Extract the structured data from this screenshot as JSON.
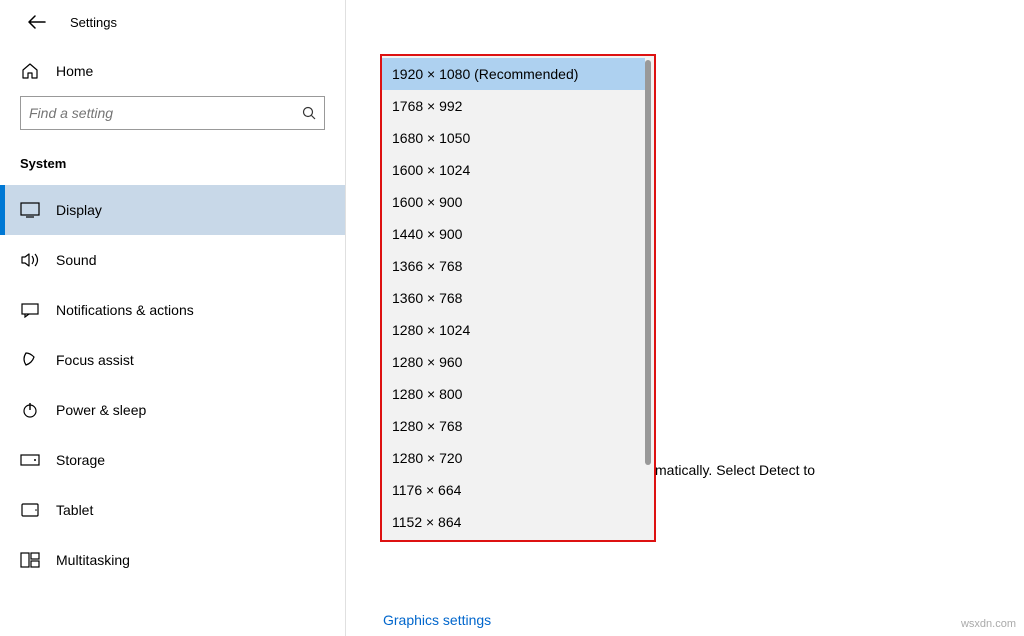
{
  "header": {
    "title": "Settings"
  },
  "sidebar": {
    "home": "Home",
    "searchPlaceholder": "Find a setting",
    "category": "System",
    "items": [
      {
        "label": "Display"
      },
      {
        "label": "Sound"
      },
      {
        "label": "Notifications & actions"
      },
      {
        "label": "Focus assist"
      },
      {
        "label": "Power & sleep"
      },
      {
        "label": "Storage"
      },
      {
        "label": "Tablet"
      },
      {
        "label": "Multitasking"
      }
    ]
  },
  "resolutions": {
    "options": [
      "1920 × 1080 (Recommended)",
      "1768 × 992",
      "1680 × 1050",
      "1600 × 1024",
      "1600 × 900",
      "1440 × 900",
      "1366 × 768",
      "1360 × 768",
      "1280 × 1024",
      "1280 × 960",
      "1280 × 800",
      "1280 × 768",
      "1280 × 720",
      "1176 × 664",
      "1152 × 864"
    ]
  },
  "main": {
    "partialText": "matically. Select Detect to",
    "link": "Graphics settings"
  },
  "watermark": "wsxdn.com"
}
